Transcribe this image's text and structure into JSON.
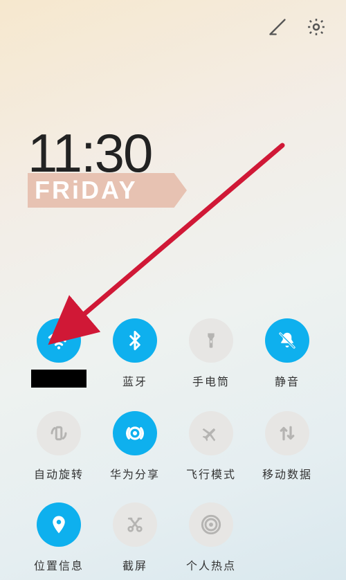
{
  "clock": {
    "time": "11:30",
    "day": "FRiDAY"
  },
  "topbar": {
    "edit": "edit",
    "settings": "settings"
  },
  "tiles": [
    {
      "key": "wifi",
      "label": "",
      "state": "on",
      "redacted": true
    },
    {
      "key": "bluetooth",
      "label": "蓝牙",
      "state": "on"
    },
    {
      "key": "flashlight",
      "label": "手电筒",
      "state": "off"
    },
    {
      "key": "mute",
      "label": "静音",
      "state": "on"
    },
    {
      "key": "autorotate",
      "label": "自动旋转",
      "state": "off"
    },
    {
      "key": "hwshare",
      "label": "华为分享",
      "state": "on"
    },
    {
      "key": "airplane",
      "label": "飞行模式",
      "state": "off"
    },
    {
      "key": "mobiledata",
      "label": "移动数据",
      "state": "off"
    },
    {
      "key": "location",
      "label": "位置信息",
      "state": "on"
    },
    {
      "key": "screenshot",
      "label": "截屏",
      "state": "off"
    },
    {
      "key": "hotspot",
      "label": "个人热点",
      "state": "off"
    }
  ],
  "annotation": {
    "arrow_color": "#d01836"
  }
}
